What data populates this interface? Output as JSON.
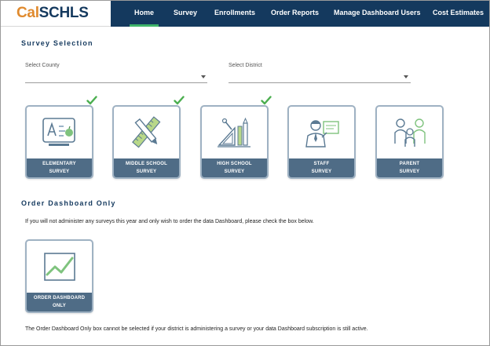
{
  "header": {
    "logo_cal": "Cal",
    "logo_schls": "SCHLS",
    "nav": [
      {
        "label": "Home",
        "active": true
      },
      {
        "label": "Survey",
        "active": false
      },
      {
        "label": "Enrollments",
        "active": false
      },
      {
        "label": "Order Reports",
        "active": false
      },
      {
        "label": "Manage Dashboard Users",
        "active": false
      },
      {
        "label": "Cost Estimates",
        "active": false
      }
    ]
  },
  "survey_selection": {
    "title": "Survey Selection",
    "county_label": "Select County",
    "county_value": "",
    "district_label": "Select District",
    "district_value": "",
    "cards": [
      {
        "line1": "ELEMENTARY",
        "line2": "SURVEY",
        "checked": true,
        "icon": "elementary-school-icon"
      },
      {
        "line1": "MIDDLE SCHOOL",
        "line2": "SURVEY",
        "checked": true,
        "icon": "ruler-pencil-icon"
      },
      {
        "line1": "HIGH SCHOOL",
        "line2": "SURVEY",
        "checked": true,
        "icon": "school-supplies-icon"
      },
      {
        "line1": "STAFF",
        "line2": "SURVEY",
        "checked": false,
        "icon": "teacher-icon"
      },
      {
        "line1": "PARENT",
        "line2": "SURVEY",
        "checked": false,
        "icon": "family-icon"
      }
    ]
  },
  "order_dashboard": {
    "title": "Order Dashboard Only",
    "instruction": "If you will not administer any surveys this year and only wish to order the data Dashboard, please check the box below.",
    "card_line1": "ORDER DASHBOARD",
    "card_line2": "ONLY",
    "card_icon": "line-chart-icon",
    "note": "The Order Dashboard Only box cannot be selected if your district is administering a survey or your data Dashboard subscription is still active."
  },
  "colors": {
    "nav_bg": "#14395e",
    "active_underline": "#3eb369",
    "card_label_bg": "#4f6c86",
    "check": "#4caf50",
    "logo_orange": "#e08a2e"
  }
}
